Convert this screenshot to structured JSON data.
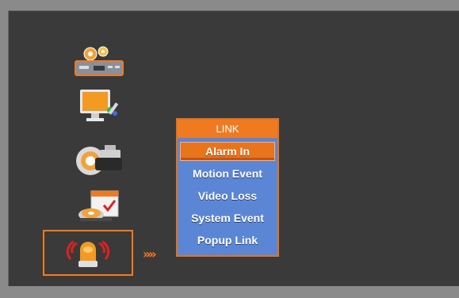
{
  "menu": {
    "items": [
      {
        "icon": "system-setup-icon"
      },
      {
        "icon": "display-monitor-icon"
      },
      {
        "icon": "camera-icon"
      },
      {
        "icon": "record-calendar-icon"
      },
      {
        "icon": "alarm-siren-icon",
        "selected": true
      }
    ],
    "arrow_glyph": "»»"
  },
  "popup": {
    "title": "LINK",
    "items": [
      "Alarm In",
      "Motion Event",
      "Video Loss",
      "System Event",
      "Popup Link"
    ],
    "selected_index": 0
  },
  "colors": {
    "accent": "#f07a22",
    "popup_bg": "#5b86d6",
    "screen_bg": "#3a3a3a"
  }
}
